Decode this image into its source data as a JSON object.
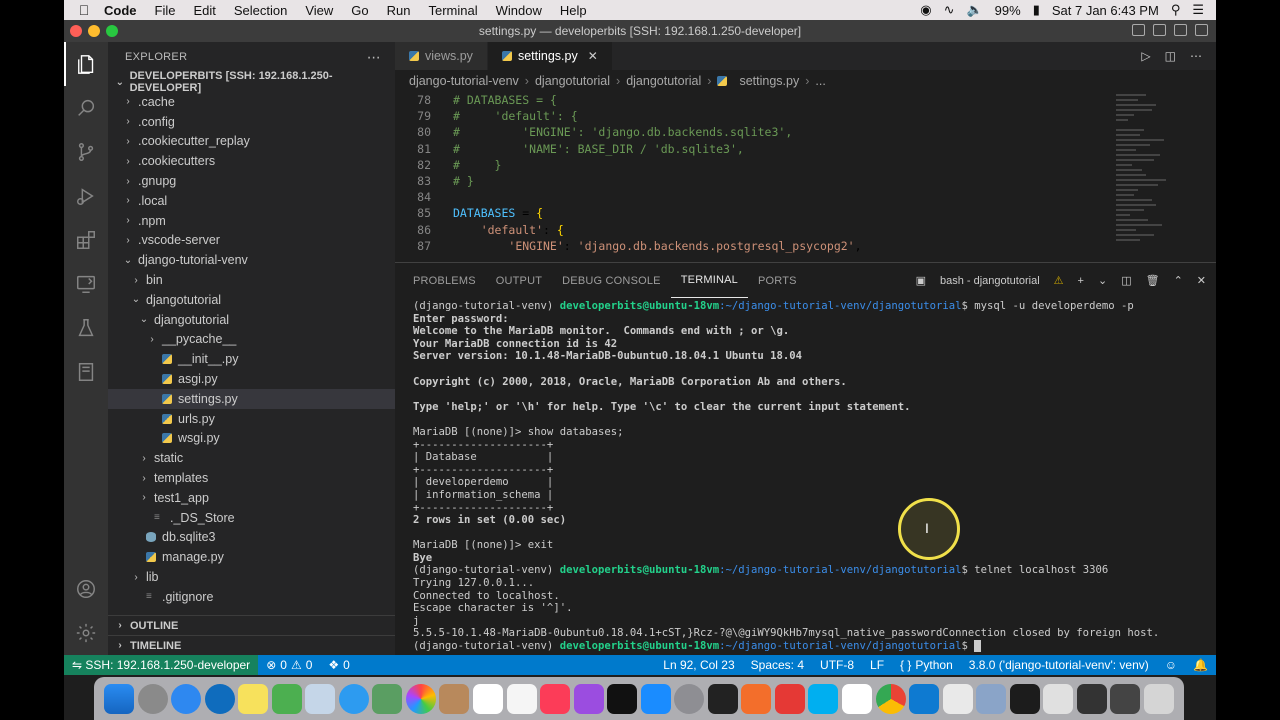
{
  "menubar": {
    "app": "Code",
    "items": [
      "File",
      "Edit",
      "Selection",
      "View",
      "Go",
      "Run",
      "Terminal",
      "Window",
      "Help"
    ],
    "battery": "99%",
    "clock": "Sat 7 Jan  6:43 PM"
  },
  "window": {
    "title": "settings.py — developerbits [SSH: 192.168.1.250-developer]"
  },
  "sidebar": {
    "header": "EXPLORER",
    "root": "DEVELOPERBITS [SSH: 192.168.1.250-DEVELOPER]",
    "tree": [
      {
        "label": ".cache",
        "type": "folder",
        "expanded": false
      },
      {
        "label": ".config",
        "type": "folder",
        "expanded": false
      },
      {
        "label": ".cookiecutter_replay",
        "type": "folder",
        "expanded": false
      },
      {
        "label": ".cookiecutters",
        "type": "folder",
        "expanded": false
      },
      {
        "label": ".gnupg",
        "type": "folder",
        "expanded": false
      },
      {
        "label": ".local",
        "type": "folder",
        "expanded": false
      },
      {
        "label": ".npm",
        "type": "folder",
        "expanded": false
      },
      {
        "label": ".vscode-server",
        "type": "folder",
        "expanded": false
      },
      {
        "label": "django-tutorial-venv",
        "type": "folder",
        "expanded": true
      },
      {
        "label": "bin",
        "type": "folder",
        "expanded": false
      },
      {
        "label": "djangotutorial",
        "type": "folder",
        "expanded": true
      },
      {
        "label": "djangotutorial",
        "type": "folder",
        "expanded": true
      },
      {
        "label": "__pycache__",
        "type": "folder",
        "expanded": false
      },
      {
        "label": "__init__.py",
        "type": "py"
      },
      {
        "label": "asgi.py",
        "type": "py"
      },
      {
        "label": "settings.py",
        "type": "py",
        "selected": true
      },
      {
        "label": "urls.py",
        "type": "py"
      },
      {
        "label": "wsgi.py",
        "type": "py"
      },
      {
        "label": "static",
        "type": "folder",
        "expanded": false
      },
      {
        "label": "templates",
        "type": "folder",
        "expanded": false
      },
      {
        "label": "test1_app",
        "type": "folder",
        "expanded": false
      },
      {
        "label": "._DS_Store",
        "type": "file"
      },
      {
        "label": "db.sqlite3",
        "type": "db"
      },
      {
        "label": "manage.py",
        "type": "py"
      },
      {
        "label": "lib",
        "type": "folder",
        "expanded": false
      },
      {
        "label": ".gitignore",
        "type": "file"
      }
    ],
    "outline": "OUTLINE",
    "timeline": "TIMELINE"
  },
  "tabs": [
    {
      "label": "views.py",
      "active": false
    },
    {
      "label": "settings.py",
      "active": true
    }
  ],
  "breadcrumb": [
    "django-tutorial-venv",
    "djangotutorial",
    "djangotutorial",
    "settings.py",
    "..."
  ],
  "editor": {
    "lines": [
      {
        "n": "78",
        "text": "# DATABASES = {"
      },
      {
        "n": "79",
        "text": "#     'default': {"
      },
      {
        "n": "80",
        "text": "#         'ENGINE': 'django.db.backends.sqlite3',"
      },
      {
        "n": "81",
        "text": "#         'NAME': BASE_DIR / 'db.sqlite3',"
      },
      {
        "n": "82",
        "text": "#     }"
      },
      {
        "n": "83",
        "text": "# }"
      },
      {
        "n": "84",
        "text": ""
      },
      {
        "n": "85",
        "text": "DATABASES = {"
      },
      {
        "n": "86",
        "text": "    'default': {"
      },
      {
        "n": "87",
        "text": "        'ENGINE': 'django.db.backends.postgresql_psycopg2',"
      }
    ]
  },
  "panel": {
    "tabs": [
      "PROBLEMS",
      "OUTPUT",
      "DEBUG CONSOLE",
      "TERMINAL",
      "PORTS"
    ],
    "active_tab": "TERMINAL",
    "terminal_name": "bash - djangotutorial",
    "terminal": {
      "venv": "(django-tutorial-venv) ",
      "user": "developerbits@ubuntu-18vm",
      "path": ":~/django-tutorial-venv/djangotutorial",
      "cmd1": "$ mysql -u developerdemo -p",
      "l_enter_pw": "Enter password:",
      "l_welcome": "Welcome to the MariaDB monitor.  Commands end with ; or \\g.",
      "l_conn_id": "Your MariaDB connection id is 42",
      "l_version": "Server version: 10.1.48-MariaDB-0ubuntu0.18.04.1 Ubuntu 18.04",
      "l_copyright": "Copyright (c) 2000, 2018, Oracle, MariaDB Corporation Ab and others.",
      "l_help": "Type 'help;' or '\\h' for help. Type '\\c' to clear the current input statement.",
      "l_show": "MariaDB [(none)]> show databases;",
      "l_border": "+--------------------+",
      "l_head": "| Database           |",
      "l_row1": "| developerdemo      |",
      "l_row2": "| information_schema |",
      "l_count": "2 rows in set (0.00 sec)",
      "l_exit": "MariaDB [(none)]> exit",
      "l_bye": "Bye",
      "cmd2": "$ telnet localhost 3306",
      "l_trying": "Trying 127.0.0.1...",
      "l_connected": "Connected to localhost.",
      "l_escape": "Escape character is '^]'.",
      "l_j": "j",
      "l_banner": "5.5.5-10.1.48-MariaDB-0ubuntu0.18.04.1+cST,}Rcz-?@\\@giWY9QkHb7mysql_native_passwordConnection closed by foreign host.",
      "cmd3": "$ "
    }
  },
  "statusbar": {
    "remote": "SSH: 192.168.1.250-developer",
    "errors": "0",
    "warnings": "0",
    "ports": "0",
    "position": "Ln 92, Col 23",
    "spaces": "Spaces: 4",
    "encoding": "UTF-8",
    "eol": "LF",
    "language": "Python",
    "interpreter": "3.8.0 ('django-tutorial-venv': venv)"
  },
  "colors": {
    "accent": "#007acc",
    "remote": "#16825d",
    "prompt_user": "#23d18b",
    "prompt_path": "#3b8eea"
  }
}
